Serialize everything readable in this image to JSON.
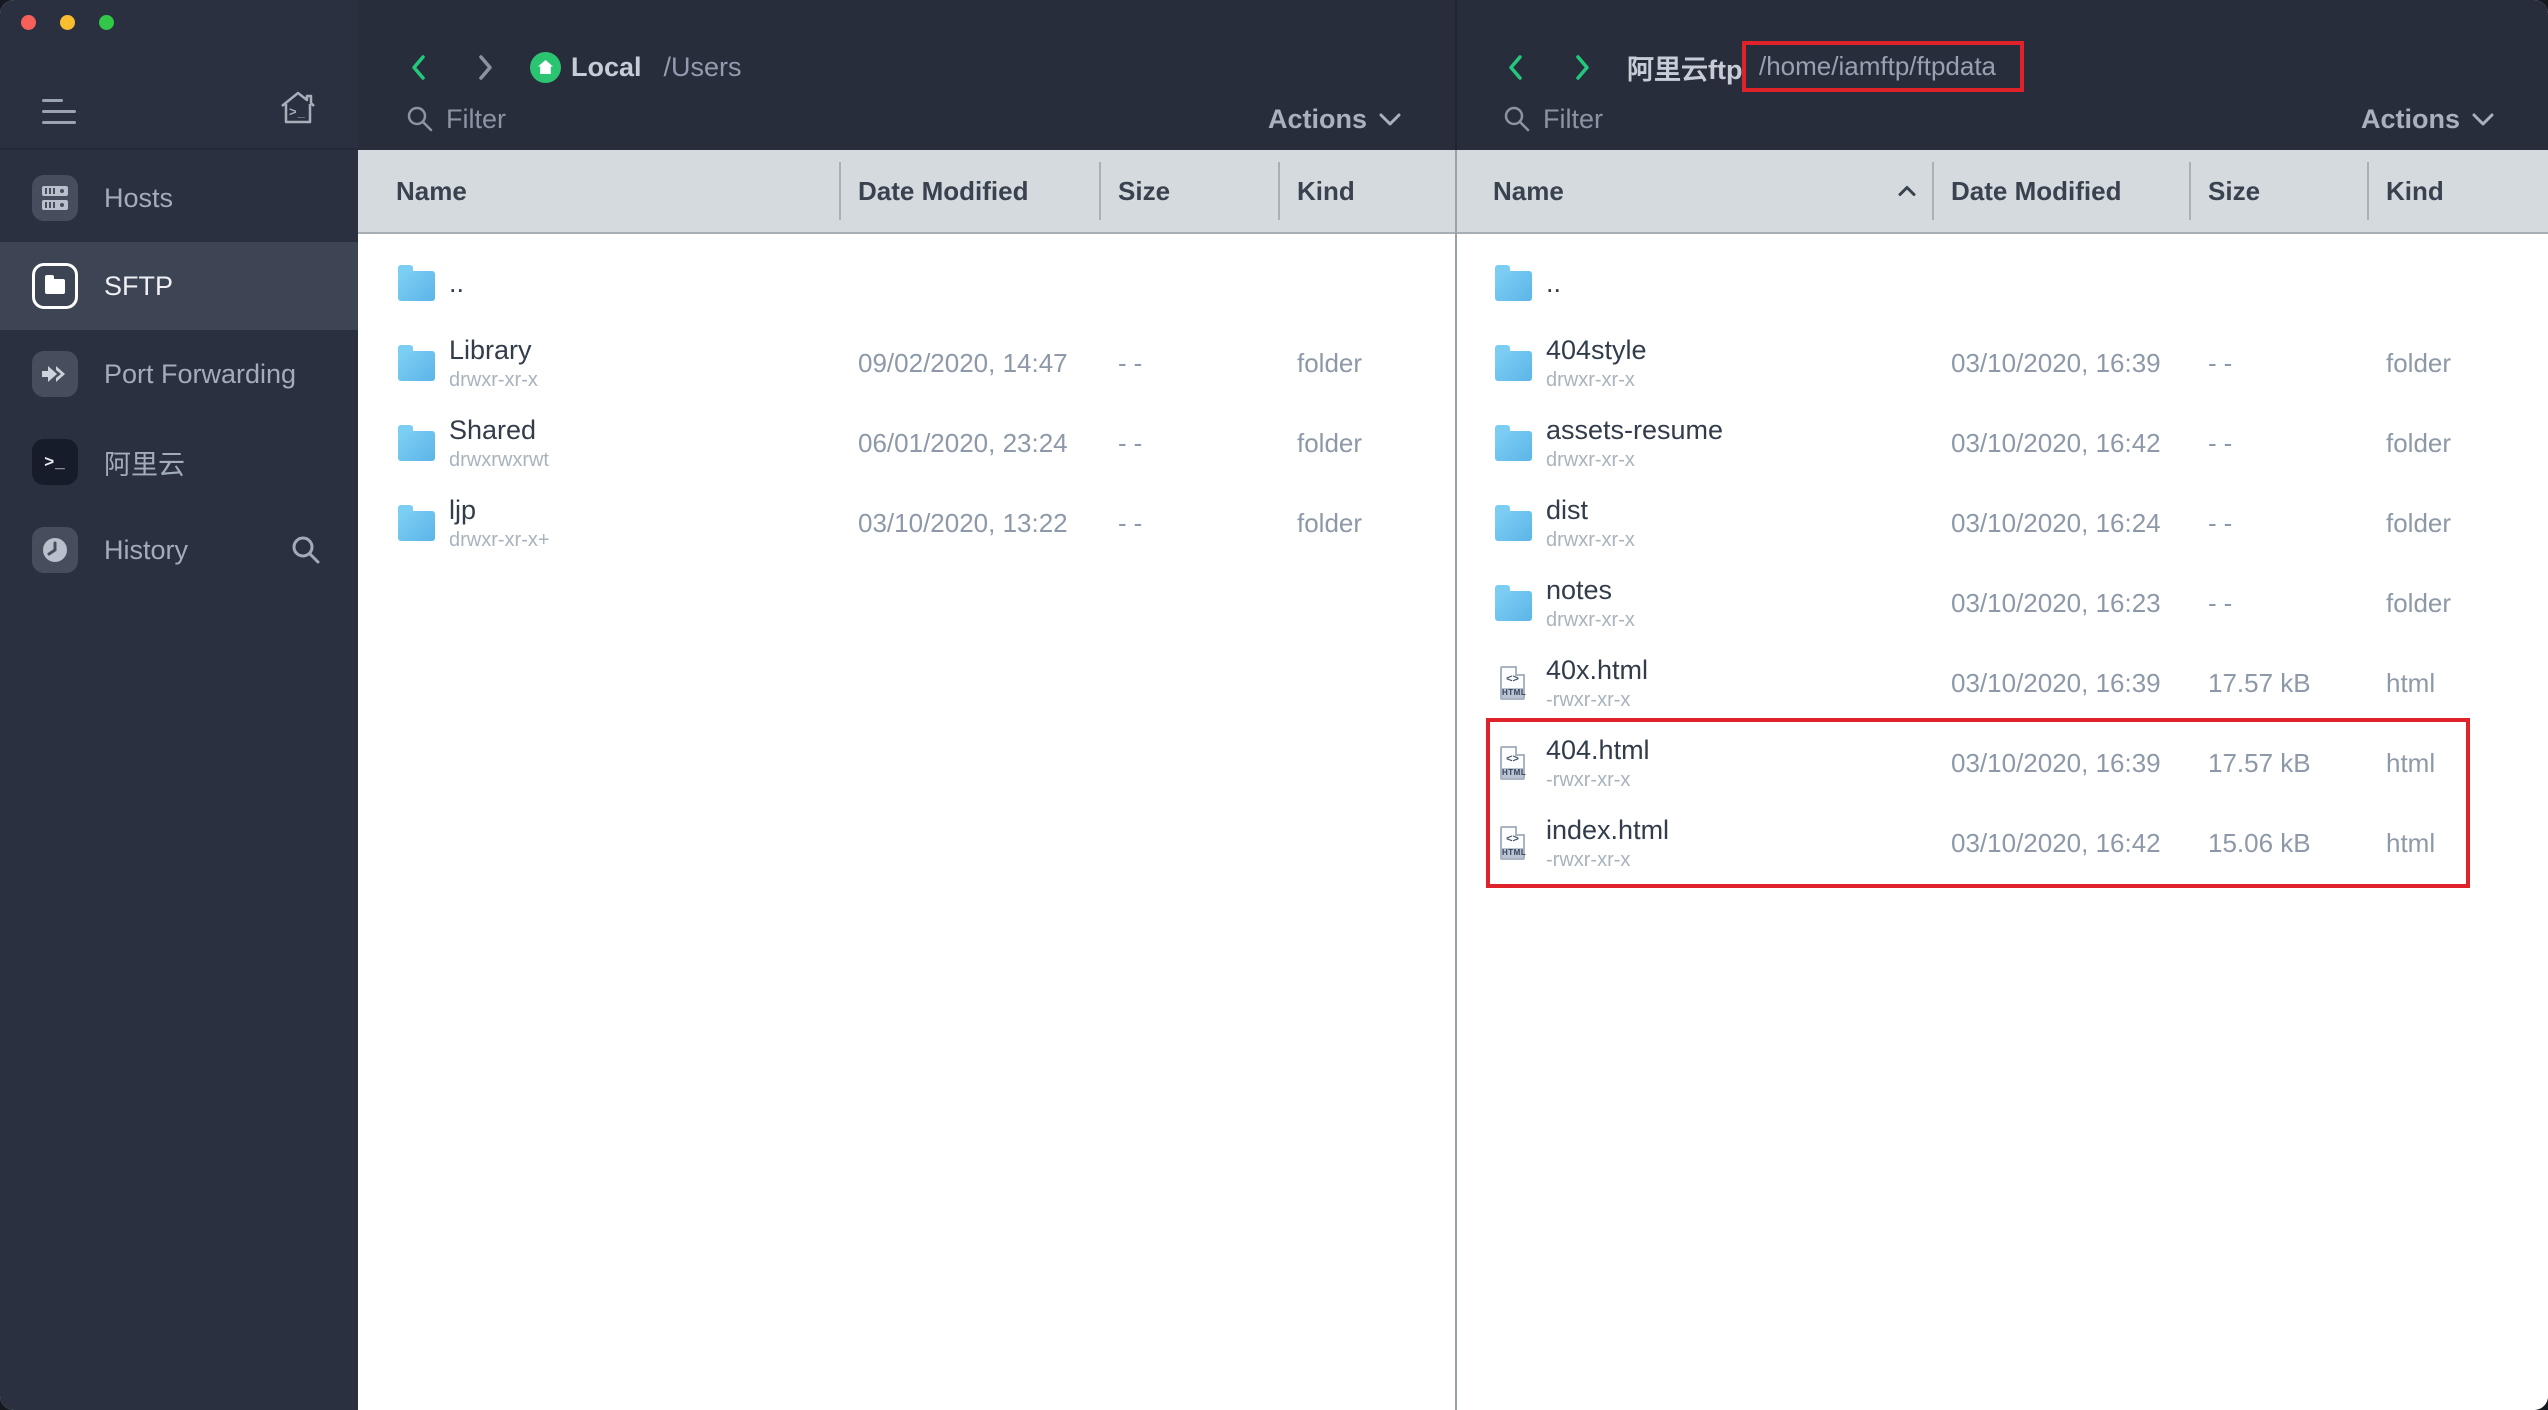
{
  "sidebar": {
    "items": [
      {
        "label": "Hosts"
      },
      {
        "label": "SFTP"
      },
      {
        "label": "Port Forwarding"
      },
      {
        "label": "阿里云"
      },
      {
        "label": "History"
      }
    ]
  },
  "icons": {
    "terminal_glyph": ">_",
    "code_glyph": "<>",
    "html_badge": "HTML"
  },
  "left_panel": {
    "title": "Local",
    "path": "/Users",
    "filter_placeholder": "Filter",
    "actions_label": "Actions",
    "columns": {
      "name": "Name",
      "date": "Date Modified",
      "size": "Size",
      "kind": "Kind"
    },
    "rows": [
      {
        "name": ".."
      },
      {
        "name": "Library",
        "perm": "drwxr-xr-x",
        "date": "09/02/2020, 14:47",
        "size": "--",
        "kind": "folder"
      },
      {
        "name": "Shared",
        "perm": "drwxrwxrwt",
        "date": "06/01/2020, 23:24",
        "size": "--",
        "kind": "folder"
      },
      {
        "name": "ljp",
        "perm": "drwxr-xr-x+",
        "date": "03/10/2020, 13:22",
        "size": "--",
        "kind": "folder"
      }
    ]
  },
  "right_panel": {
    "title": "阿里云ftp",
    "path": "/home/iamftp/ftpdata",
    "filter_placeholder": "Filter",
    "actions_label": "Actions",
    "sort": {
      "column": "Name",
      "direction": "ascending"
    },
    "columns": {
      "name": "Name",
      "date": "Date Modified",
      "size": "Size",
      "kind": "Kind"
    },
    "rows": [
      {
        "name": ".."
      },
      {
        "name": "404style",
        "perm": "drwxr-xr-x",
        "date": "03/10/2020, 16:39",
        "size": "--",
        "kind": "folder"
      },
      {
        "name": "assets-resume",
        "perm": "drwxr-xr-x",
        "date": "03/10/2020, 16:42",
        "size": "--",
        "kind": "folder"
      },
      {
        "name": "dist",
        "perm": "drwxr-xr-x",
        "date": "03/10/2020, 16:24",
        "size": "--",
        "kind": "folder"
      },
      {
        "name": "notes",
        "perm": "drwxr-xr-x",
        "date": "03/10/2020, 16:23",
        "size": "--",
        "kind": "folder"
      },
      {
        "name": "40x.html",
        "perm": "-rwxr-xr-x",
        "date": "03/10/2020, 16:39",
        "size": "17.57 kB",
        "kind": "html"
      },
      {
        "name": "404.html",
        "perm": "-rwxr-xr-x",
        "date": "03/10/2020, 16:39",
        "size": "17.57 kB",
        "kind": "html"
      },
      {
        "name": "index.html",
        "perm": "-rwxr-xr-x",
        "date": "03/10/2020, 16:42",
        "size": "15.06 kB",
        "kind": "html"
      }
    ]
  },
  "annotations": {
    "path_box_target": "/home/iamftp/ftpdata",
    "rows_box_targets": [
      "404.html",
      "index.html"
    ],
    "color": "#e0222a"
  },
  "colors": {
    "accent_green": "#24c87d",
    "home_chip_green": "#2bc571",
    "annotation_red": "#e0222a",
    "folder_blue": "#68c2ee",
    "sidebar_bg": "#2b3040",
    "panel_header_bg": "#282d3b",
    "table_header_bg": "#d5dade",
    "selected_item_bg": "#3d4454"
  }
}
